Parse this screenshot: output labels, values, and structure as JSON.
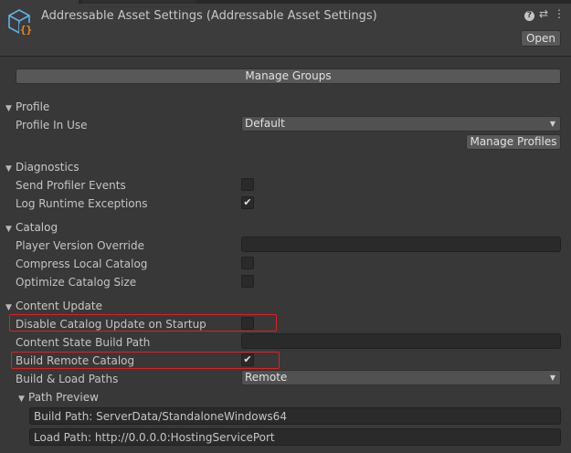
{
  "window": {
    "title": "Addressable Asset Settings (Addressable Asset Settings)",
    "open_button": "Open",
    "icons": [
      "help-icon",
      "presets-icon",
      "more-icon"
    ],
    "help_glyph": "?",
    "presets_glyph": "⇄",
    "more_glyph": "⋮"
  },
  "manage_groups": "Manage Groups",
  "profile": {
    "header": "Profile",
    "profile_in_use_label": "Profile In Use",
    "profile_in_use_value": "Default",
    "manage_profiles": "Manage Profiles"
  },
  "diagnostics": {
    "header": "Diagnostics",
    "send_profiler_events": {
      "label": "Send Profiler Events",
      "checked": false
    },
    "log_runtime_exceptions": {
      "label": "Log Runtime Exceptions",
      "checked": true
    }
  },
  "catalog": {
    "header": "Catalog",
    "player_version_override": {
      "label": "Player Version Override",
      "value": ""
    },
    "compress_local_catalog": {
      "label": "Compress Local Catalog",
      "checked": false
    },
    "optimize_catalog_size": {
      "label": "Optimize Catalog Size",
      "checked": false
    }
  },
  "content_update": {
    "header": "Content Update",
    "disable_catalog_update": {
      "label": "Disable Catalog Update on Startup",
      "checked": false
    },
    "content_state_build_path": {
      "label": "Content State Build Path",
      "value": ""
    },
    "build_remote_catalog": {
      "label": "Build Remote Catalog",
      "checked": true
    },
    "build_load_paths": {
      "label": "Build & Load Paths",
      "value": "Remote"
    },
    "path_preview": {
      "header": "Path Preview",
      "build_path": "Build Path: ServerData/StandaloneWindows64",
      "load_path": "Load Path: http://0.0.0.0:HostingServicePort"
    }
  },
  "glyphs": {
    "check": "✔",
    "tri_down": "▼",
    "caret_down": "▼"
  },
  "colors": {
    "background": "#383838",
    "highlight": "#e02020",
    "button": "#585858"
  }
}
